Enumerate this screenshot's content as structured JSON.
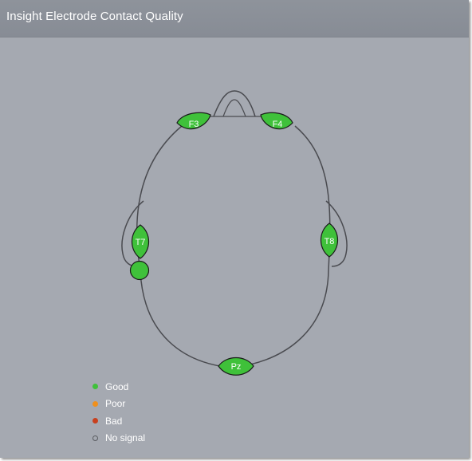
{
  "window": {
    "title": "Insight Electrode Contact Quality"
  },
  "colors": {
    "background": "#a5a9b1",
    "titlebar": "#8b9098",
    "outline": "#4a4b50",
    "good": "#3fc13a",
    "poor": "#f0901c",
    "bad": "#c8401e",
    "no_signal": "#5a5c61"
  },
  "electrodes": [
    {
      "label": "F3",
      "status": "good"
    },
    {
      "label": "F4",
      "status": "good"
    },
    {
      "label": "T7",
      "status": "good"
    },
    {
      "label": "T8",
      "status": "good"
    },
    {
      "label": "Pz",
      "status": "good"
    },
    {
      "label": "",
      "status": "good"
    }
  ],
  "legend": [
    {
      "label": "Good",
      "status": "good"
    },
    {
      "label": "Poor",
      "status": "poor"
    },
    {
      "label": "Bad",
      "status": "bad"
    },
    {
      "label": "No signal",
      "status": "no_signal"
    }
  ]
}
